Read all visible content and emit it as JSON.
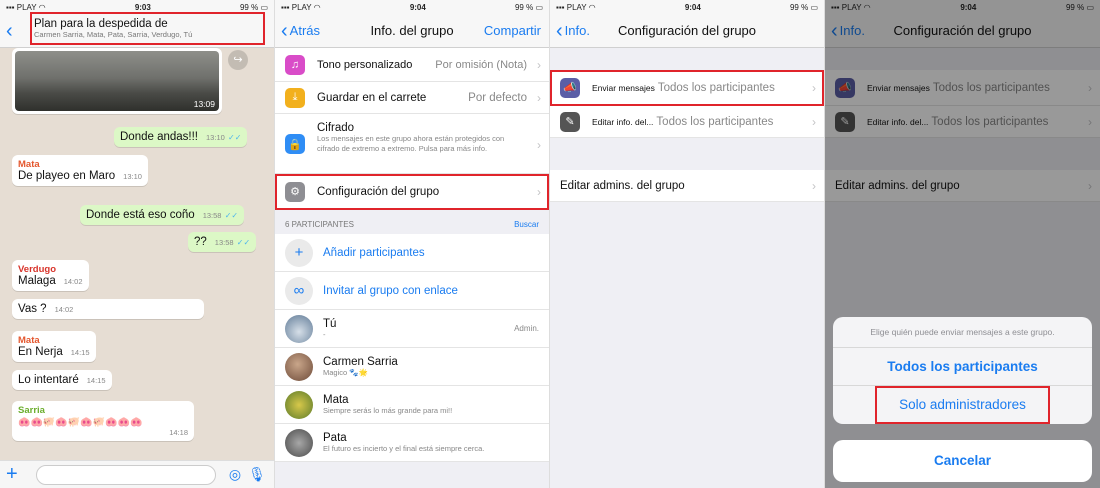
{
  "screen1": {
    "status": {
      "carrier": "PLAY",
      "time": "9:03",
      "battery": "99 %"
    },
    "group_name": "Plan para la despedida de",
    "group_members": "Carmen Sarria, Mata, Pata, Sarria, Verdugo, Tú",
    "photo_time": "13:09",
    "messages": [
      {
        "text": "Donde andas!!!",
        "time": "13:10"
      },
      {
        "sender": "Mata",
        "text": "De playeo en Maro",
        "time": "13:10"
      },
      {
        "text": "Donde está eso coño",
        "time": "13:58"
      },
      {
        "text": "??",
        "time": "13:58"
      },
      {
        "sender": "Verdugo",
        "text": "Malaga",
        "time": "14:02"
      },
      {
        "text": "Vas                              ?",
        "time": "14:02"
      },
      {
        "sender": "Mata",
        "text": "En Nerja",
        "time": "14:15"
      },
      {
        "text": "Lo intentaré",
        "time": "14:15"
      },
      {
        "sender": "Sarria",
        "text": "🐽🐽🐖🐽🐖🐽🐖🐽🐽🐽",
        "time": "14:18"
      }
    ],
    "colors": {
      "mata": "#e4572e",
      "verdugo": "#d8342b",
      "sarria": "#6cae2e"
    }
  },
  "screen2": {
    "status": {
      "carrier": "PLAY",
      "time": "9:04",
      "battery": "99 %"
    },
    "back": "Atrás",
    "title": "Info. del grupo",
    "share": "Compartir",
    "rows": {
      "tono": {
        "label": "Tono personalizado",
        "value": "Por omisión (Nota)"
      },
      "carrete": {
        "label": "Guardar en el carrete",
        "value": "Por defecto"
      },
      "cifrado": {
        "label": "Cifrado",
        "sub": "Los mensajes en este grupo ahora están protegidos con cifrado de extremo a extremo. Pulsa para más info."
      },
      "config": {
        "label": "Configuración del grupo"
      }
    },
    "participants_header": "6 PARTICIPANTES",
    "search": "Buscar",
    "add": "Añadir participantes",
    "invite": "Invitar al grupo con enlace",
    "people": [
      {
        "name": "Tú",
        "status": "-",
        "badge": "Admin."
      },
      {
        "name": "Carmen Sarria",
        "status": "Magico 🐾🌟"
      },
      {
        "name": "Mata",
        "status": "Siempre serás lo más grande para mi!!"
      },
      {
        "name": "Pata",
        "status": "El futuro es incierto y el final está siempre cerca."
      }
    ]
  },
  "screen3": {
    "status": {
      "carrier": "PLAY",
      "time": "9:04",
      "battery": "99 %"
    },
    "back": "Info.",
    "title": "Configuración del grupo",
    "send": {
      "label": "Enviar mensajes",
      "value": "Todos los participantes"
    },
    "edit": {
      "label": "Editar info. del...",
      "value": "Todos los participantes"
    },
    "admins": "Editar admins. del grupo"
  },
  "screen4": {
    "status": {
      "carrier": "PLAY",
      "time": "9:04",
      "battery": "99 %"
    },
    "back": "Info.",
    "title": "Configuración del grupo",
    "send": {
      "label": "Enviar mensajes",
      "value": "Todos los participantes"
    },
    "edit": {
      "label": "Editar info. del...",
      "value": "Todos los participantes"
    },
    "admins": "Editar admins. del grupo",
    "sheet_message": "Elige quién puede enviar mensajes a este grupo.",
    "option_all": "Todos los participantes",
    "option_admins": "Solo administradores",
    "cancel": "Cancelar"
  }
}
